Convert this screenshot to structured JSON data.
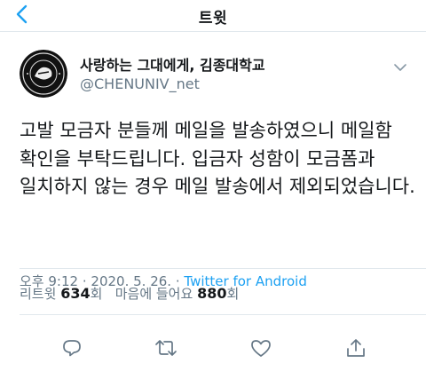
{
  "nav": {
    "title": "트윗"
  },
  "tweet": {
    "author_name": "사랑하는 그대에게, 김종대학교",
    "handle": "@CHENUNIV_net",
    "text": "고발 모금자 분들께 메일을 발송하였으니 메일함 확인을 부탁드립니다. 입금자 성함이 모금폼과 일치하지 않는 경우 메일 발송에서 제외되었습니다.",
    "time": "오후 9:12",
    "dot": "·",
    "date": "2020. 5. 26.",
    "source": "Twitter for Android"
  },
  "stats": {
    "retweets_label": "리트윗",
    "retweets_count": "634",
    "retweets_unit": "회",
    "likes_label": "마음에 들어요",
    "likes_count": "880",
    "likes_unit": "회"
  },
  "icons": {
    "back": "chevron-left-icon",
    "caret": "chevron-down-icon",
    "reply": "reply-icon",
    "retweet": "retweet-icon",
    "like": "heart-icon",
    "share": "share-icon"
  },
  "colors": {
    "accent": "#1da1f2",
    "secondary": "#657786",
    "text": "#14171a",
    "border": "#e1e8ed"
  }
}
